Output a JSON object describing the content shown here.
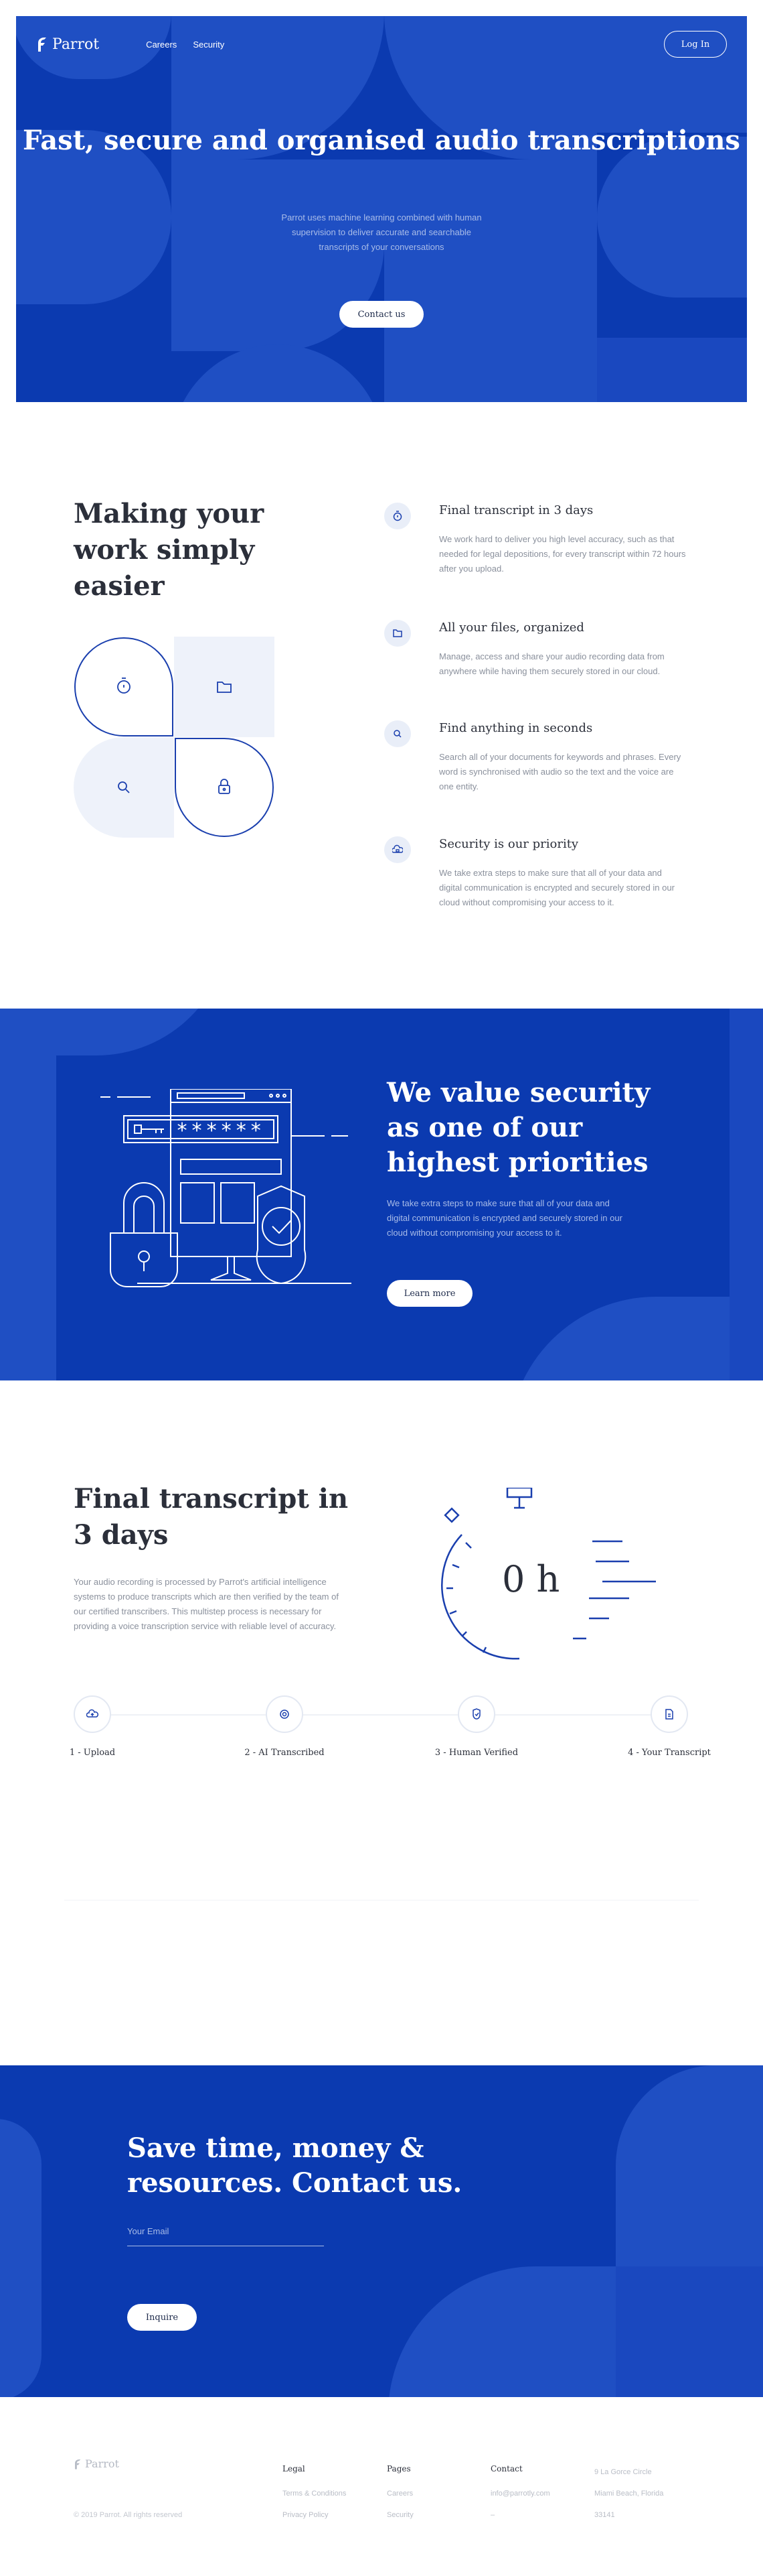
{
  "colors": {
    "brand_blue": "#0b3ab0",
    "shape_blue": "#1f4fc3",
    "icon_blue": "#1a3fae",
    "white": "#ffffff"
  },
  "nav": {
    "logo_text": "Parrot",
    "links": [
      {
        "label": "Careers"
      },
      {
        "label": "Security"
      }
    ],
    "login_label": "Log In"
  },
  "hero": {
    "title": "Fast, secure and organised audio transcriptions",
    "subtitle": "Parrot uses machine learning combined with human supervision to deliver accurate and searchable transcripts of your conversations",
    "cta_label": "Contact us"
  },
  "features": {
    "title": "Making your work simply easier",
    "items": [
      {
        "title": "Final transcript in 3 days",
        "text": "We work hard to deliver you high level accuracy, such as that needed for legal depositions, for every transcript within 72 hours after you upload.",
        "icon": "stopwatch-icon"
      },
      {
        "title": "All your files, organized",
        "text": "Manage, access and share your audio recording data from anywhere while having them securely stored in our cloud.",
        "icon": "folder-icon"
      },
      {
        "title": "Find anything in seconds",
        "text": "Search all of your documents for keywords and phrases. Every word is synchronised with audio so the text and the voice are one entity.",
        "icon": "search-icon"
      },
      {
        "title": "Security is our priority",
        "text": "We take extra steps to make sure that all of your data and digital communication is encrypted and securely stored in our cloud without compromising your access to it.",
        "icon": "cloud-lock-icon"
      }
    ]
  },
  "security": {
    "title": "We value security as one of our highest priorities",
    "text": "We take extra steps to make sure that all of your data and digital communication is encrypted and securely stored in our cloud without compromising your access to it.",
    "button_label": "Learn more",
    "password_mask": "******"
  },
  "timeline": {
    "title": "Final transcript in 3 days",
    "text": "Your audio recording is processed by Parrot's artificial intelligence systems to produce transcripts which are then verified by the team of our certified transcribers. This multistep process is necessary for providing a voice transcription service with reliable level of accuracy.",
    "timer_value": "0 h",
    "steps": [
      {
        "label": "1 - Upload",
        "icon": "cloud-upload-icon"
      },
      {
        "label": "2 - AI Transcribed",
        "icon": "target-icon"
      },
      {
        "label": "3 - Human Verified",
        "icon": "shield-check-icon"
      },
      {
        "label": "4 - Your Transcript",
        "icon": "document-icon"
      }
    ]
  },
  "cta": {
    "title": "Save time, money & resources. Contact us.",
    "email_placeholder": "Your Email",
    "button_label": "Inquire"
  },
  "footer": {
    "logo_text": "Parrot",
    "copyright": "© 2019 Parrot. All rights reserved",
    "columns": [
      {
        "heading": "Legal",
        "links": [
          "Terms & Conditions",
          "Privacy Policy"
        ]
      },
      {
        "heading": "Pages",
        "links": [
          "Careers",
          "Security"
        ]
      },
      {
        "heading": "Contact",
        "links": [
          "info@parrotly.com",
          "–"
        ]
      }
    ],
    "address": [
      "9 La Gorce Circle",
      "Miami Beach, Florida",
      "33141"
    ]
  }
}
